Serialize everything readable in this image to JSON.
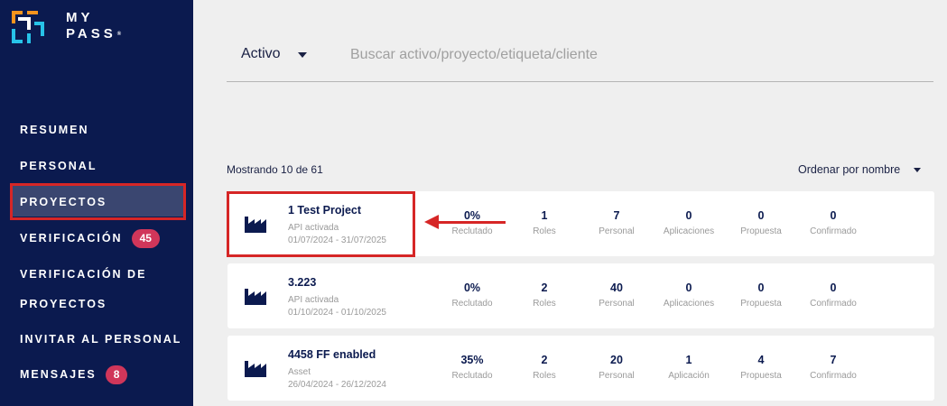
{
  "brand": {
    "line1": "MY",
    "line2": "PASS",
    "mark": "®"
  },
  "nav": {
    "resumen": "RESUMEN",
    "personal": "PERSONAL",
    "proyectos": "PROYECTOS",
    "verificacion": "VERIFICACIÓN",
    "verificacion_badge": "45",
    "verificacion_proyectos_1": "VERIFICACIÓN DE",
    "verificacion_proyectos_2": "PROYECTOS",
    "invitar": "INVITAR AL PERSONAL",
    "mensajes": "MENSAJES",
    "mensajes_badge": "8"
  },
  "filter": {
    "label": "Activo",
    "search_placeholder": "Buscar activo/proyecto/etiqueta/cliente"
  },
  "list": {
    "showing": "Mostrando 10 de 61",
    "sort": "Ordenar por nombre"
  },
  "projects": [
    {
      "name": "1 Test Project",
      "status": "API activada",
      "dates": "01/07/2024 - 31/07/2025",
      "stats": [
        {
          "v": "0%",
          "l": "Reclutado"
        },
        {
          "v": "1",
          "l": "Roles"
        },
        {
          "v": "7",
          "l": "Personal"
        },
        {
          "v": "0",
          "l": "Aplicaciones"
        },
        {
          "v": "0",
          "l": "Propuesta"
        },
        {
          "v": "0",
          "l": "Confirmado"
        }
      ]
    },
    {
      "name": "3.223",
      "status": "API activada",
      "dates": "01/10/2024 - 01/10/2025",
      "stats": [
        {
          "v": "0%",
          "l": "Reclutado"
        },
        {
          "v": "2",
          "l": "Roles"
        },
        {
          "v": "40",
          "l": "Personal"
        },
        {
          "v": "0",
          "l": "Aplicaciones"
        },
        {
          "v": "0",
          "l": "Propuesta"
        },
        {
          "v": "0",
          "l": "Confirmado"
        }
      ]
    },
    {
      "name": "4458 FF enabled",
      "status": "Asset",
      "dates": "26/04/2024 - 26/12/2024",
      "stats": [
        {
          "v": "35%",
          "l": "Reclutado"
        },
        {
          "v": "2",
          "l": "Roles"
        },
        {
          "v": "20",
          "l": "Personal"
        },
        {
          "v": "1",
          "l": "Aplicación"
        },
        {
          "v": "4",
          "l": "Propuesta"
        },
        {
          "v": "7",
          "l": "Confirmado"
        }
      ]
    }
  ],
  "colors": {
    "sidebar": "#0b1a4f",
    "accent_red": "#d62626",
    "badge": "#d0365a",
    "logo_orange": "#f7941d",
    "logo_cyan": "#27c3e8"
  }
}
